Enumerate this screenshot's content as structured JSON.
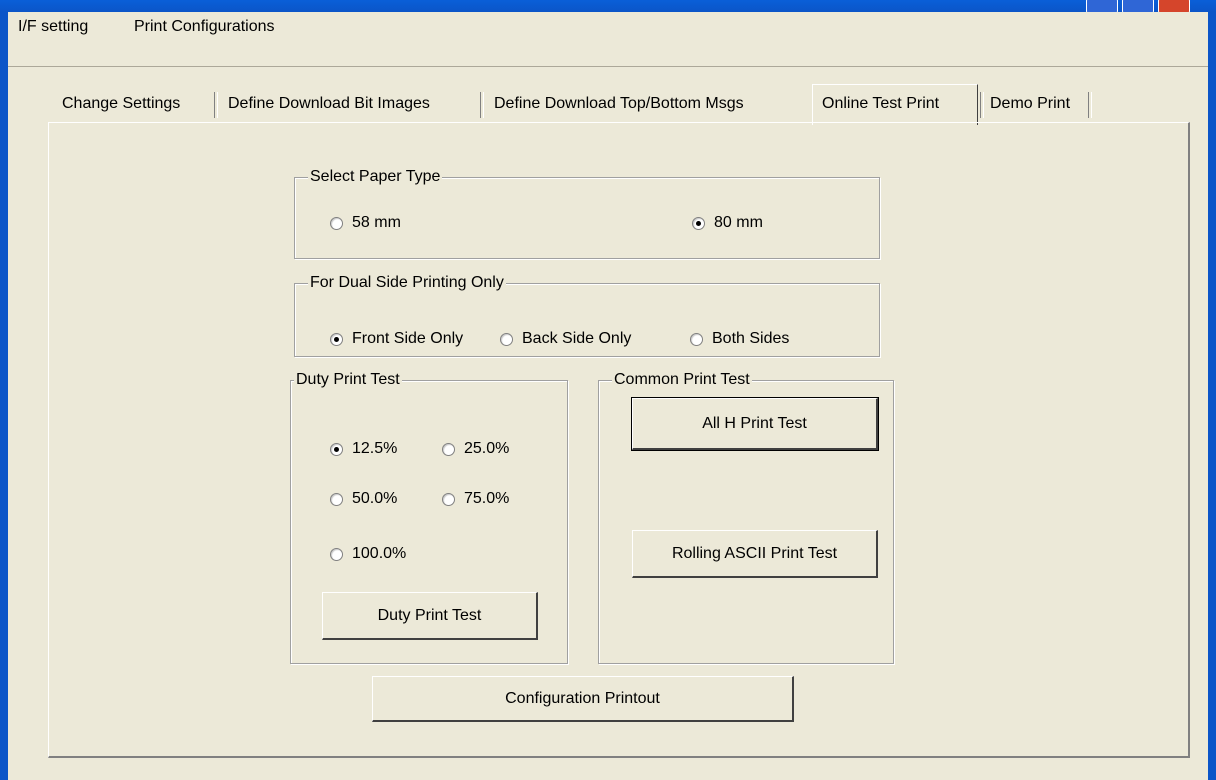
{
  "menu": {
    "items": [
      "I/F setting",
      "Print Configurations"
    ]
  },
  "tabs": [
    {
      "label": "Change Settings"
    },
    {
      "label": "Define Download Bit Images"
    },
    {
      "label": "Define Download Top/Bottom Msgs"
    },
    {
      "label": "Online Test Print",
      "active": true
    },
    {
      "label": "Demo Print"
    }
  ],
  "paper_type": {
    "title": "Select Paper Type",
    "options": [
      {
        "label": "58 mm",
        "checked": false
      },
      {
        "label": "80 mm",
        "checked": true
      }
    ]
  },
  "dual_side": {
    "title": "For Dual Side Printing Only",
    "options": [
      {
        "label": "Front Side Only",
        "checked": true
      },
      {
        "label": "Back Side Only",
        "checked": false
      },
      {
        "label": "Both Sides",
        "checked": false
      }
    ]
  },
  "duty_test": {
    "title": "Duty Print Test",
    "options": [
      {
        "label": "12.5%",
        "checked": true
      },
      {
        "label": "25.0%",
        "checked": false
      },
      {
        "label": "50.0%",
        "checked": false
      },
      {
        "label": "75.0%",
        "checked": false
      },
      {
        "label": "100.0%",
        "checked": false
      }
    ],
    "button": "Duty Print Test"
  },
  "common_test": {
    "title": "Common Print Test",
    "buttons": [
      "All H Print Test",
      "Rolling ASCII Print Test"
    ]
  },
  "config_button": "Configuration Printout",
  "colors": {
    "face": "#ece9d8",
    "titlebar": "#0b55c8",
    "close": "#d5452b"
  }
}
